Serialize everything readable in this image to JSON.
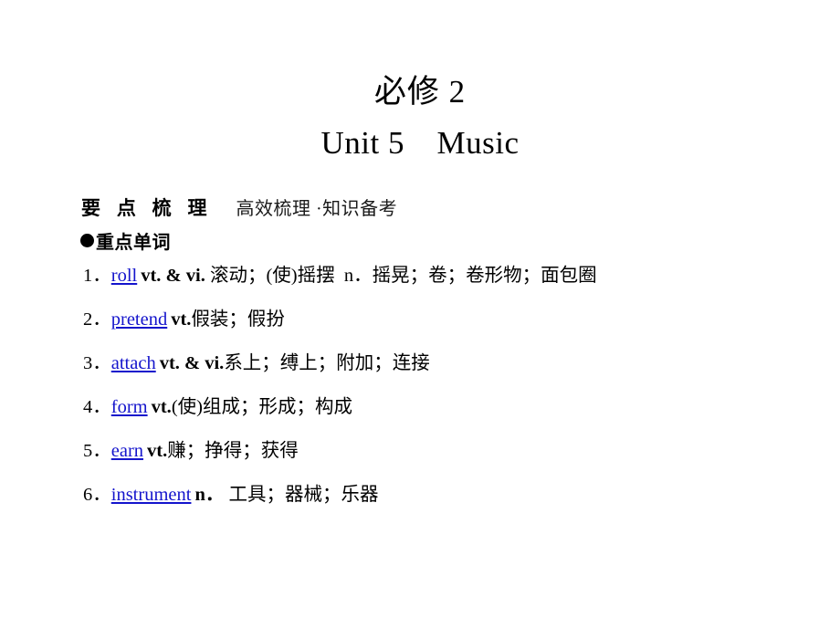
{
  "slide": {
    "background_color": "#ffffff",
    "link_color": "#1414cc",
    "text_color": "#000000"
  },
  "title": {
    "line1": "必修 2",
    "line2": "Unit 5　Music"
  },
  "section": {
    "heading": "要 点 梳 理",
    "subtitle": "高效梳理 ·知识备考"
  },
  "subsection": {
    "bullet_icon": "filled-circle-bullet",
    "label": "重点单词"
  },
  "words": [
    {
      "index": "1．",
      "term": "roll",
      "pos": "vt. & vi.",
      "definition": " 滚动；(使)摇摆  n．摇晃；卷；卷形物；面包圈"
    },
    {
      "index": "2．",
      "term": "pretend",
      "pos": "vt.",
      "definition": "假装；假扮"
    },
    {
      "index": "3．",
      "term": "attach",
      "pos": "vt. & vi.",
      "definition": "系上；缚上；附加；连接"
    },
    {
      "index": "4．",
      "term": "form",
      "pos": "vt.",
      "definition": "(使)组成；形成；构成"
    },
    {
      "index": "5．",
      "term": "earn",
      "pos": "vt.",
      "definition": "赚；挣得；获得"
    },
    {
      "index": "6．",
      "term": "instrument",
      "pos": "n．",
      "definition": " 工具；器械；乐器"
    }
  ]
}
